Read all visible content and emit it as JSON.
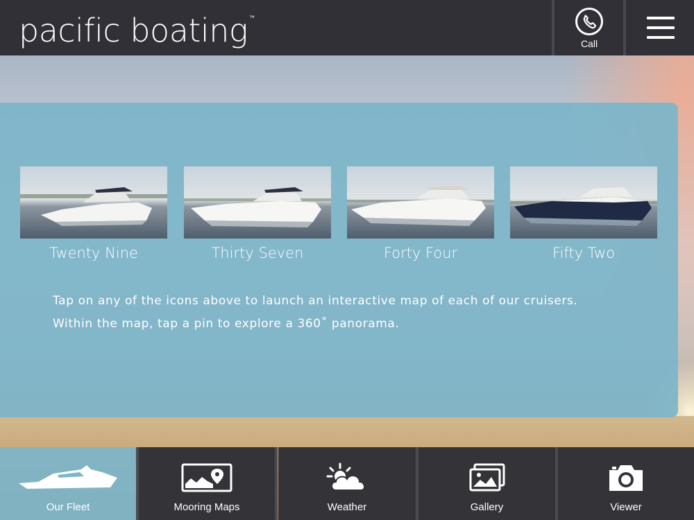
{
  "header": {
    "logo_text": "pacific boating",
    "logo_tm": "™",
    "call_label": "Call"
  },
  "fleet": [
    {
      "name": "Twenty Nine",
      "hull": "#ffffff"
    },
    {
      "name": "Thirty Seven",
      "hull": "#ffffff"
    },
    {
      "name": "Forty Four",
      "hull": "#ffffff"
    },
    {
      "name": "Fifty Two",
      "hull": "#1f2a44"
    }
  ],
  "description": {
    "line1": "Tap on any of the icons above to launch an interactive map of each of our cruisers.",
    "line2": "Within the map, tap a pin to explore a 360˚ panorama."
  },
  "nav": [
    {
      "label": "Our Fleet",
      "icon": "boat-icon",
      "active": true
    },
    {
      "label": "Mooring Maps",
      "icon": "map-pin-icon",
      "active": false
    },
    {
      "label": "Weather",
      "icon": "sun-cloud-icon",
      "active": false
    },
    {
      "label": "Gallery",
      "icon": "gallery-icon",
      "active": false
    },
    {
      "label": "Viewer",
      "icon": "camera-icon",
      "active": false
    }
  ],
  "colors": {
    "header_bg": "#303036",
    "panel": "#7db5c9",
    "nav_bg": "#343438"
  }
}
